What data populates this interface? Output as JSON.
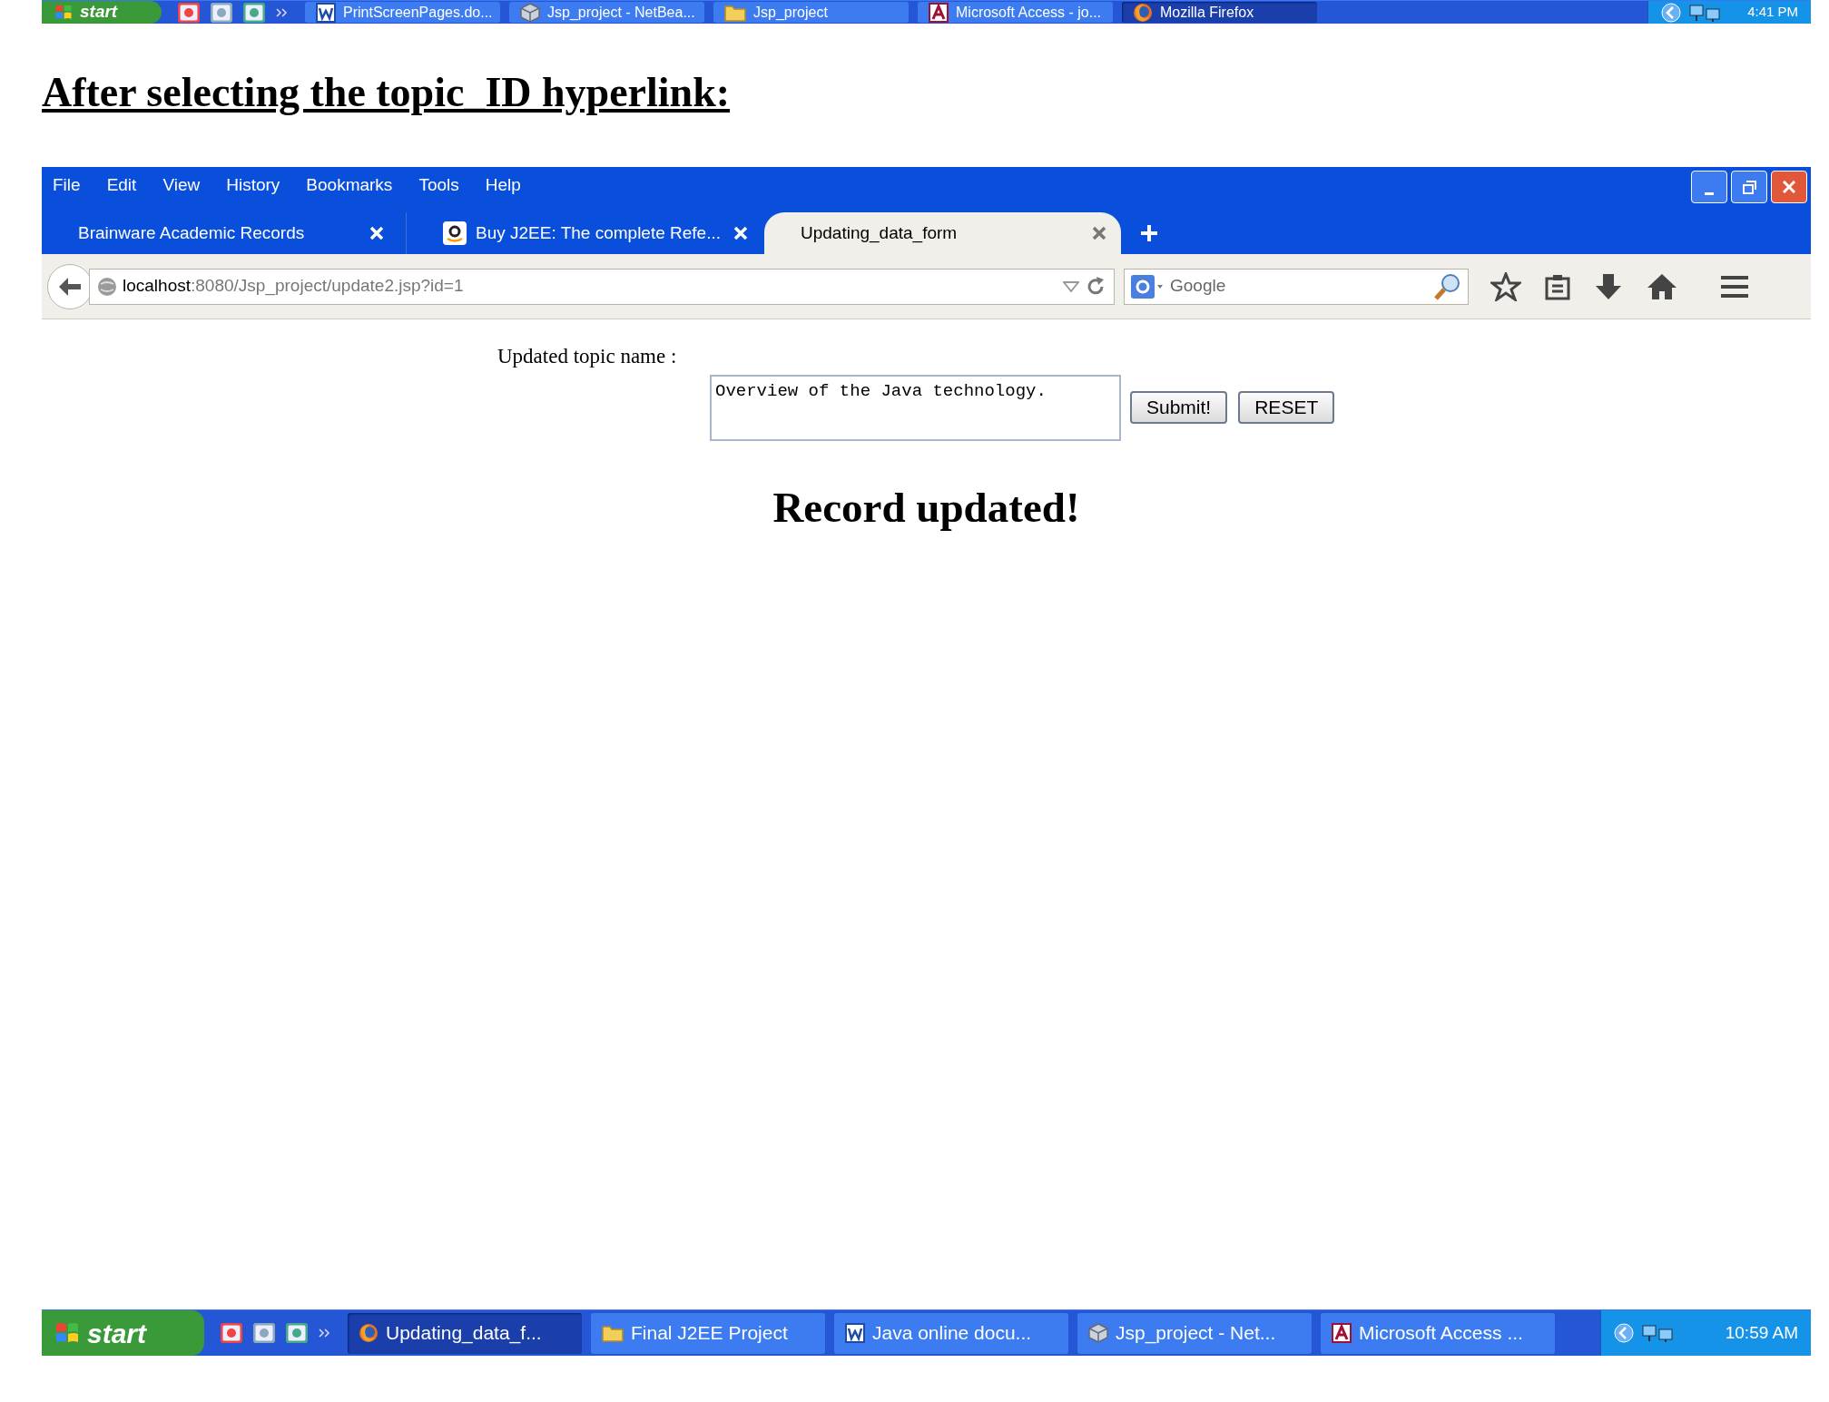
{
  "top_taskbar": {
    "start": "start",
    "items": [
      {
        "label": "PrintScreenPages.do...",
        "kind": "word",
        "selected": false
      },
      {
        "label": "Jsp_project - NetBea...",
        "kind": "cube",
        "selected": false
      },
      {
        "label": "Jsp_project",
        "kind": "folder",
        "selected": false
      },
      {
        "label": "Microsoft Access - jo...",
        "kind": "access",
        "selected": false
      },
      {
        "label": "Mozilla Firefox",
        "kind": "firefox",
        "selected": true
      }
    ],
    "clock": "4:41 PM"
  },
  "heading": "After selecting the topic_ID hyperlink:",
  "browser": {
    "menu": [
      "File",
      "Edit",
      "View",
      "History",
      "Bookmarks",
      "Tools",
      "Help"
    ],
    "tabs": [
      {
        "label": "Brainware Academic Records",
        "kind": "plain",
        "selected": false
      },
      {
        "label": "Buy J2EE: The complete Refe...",
        "kind": "shop",
        "selected": false
      },
      {
        "label": "Updating_data_form",
        "kind": "plain",
        "selected": true
      }
    ],
    "address": {
      "host": "localhost",
      "rest": ":8080/Jsp_project/update2.jsp?id=1"
    },
    "search": {
      "placeholder": "Google"
    }
  },
  "page": {
    "label": "Updated topic name :",
    "value": "Overview of the Java technology.",
    "buttons": [
      "Submit!",
      "RESET"
    ],
    "message": "Record updated!"
  },
  "bottom_taskbar": {
    "start": "start",
    "items": [
      {
        "label": "Updating_data_f...",
        "kind": "firefox",
        "selected": true
      },
      {
        "label": "Final J2EE Project",
        "kind": "folder",
        "selected": false
      },
      {
        "label": "Java online docu...",
        "kind": "word",
        "selected": false
      },
      {
        "label": "Jsp_project - Net...",
        "kind": "cube",
        "selected": false
      },
      {
        "label": "Microsoft Access ...",
        "kind": "access",
        "selected": false
      }
    ],
    "clock": "10:59 AM"
  }
}
